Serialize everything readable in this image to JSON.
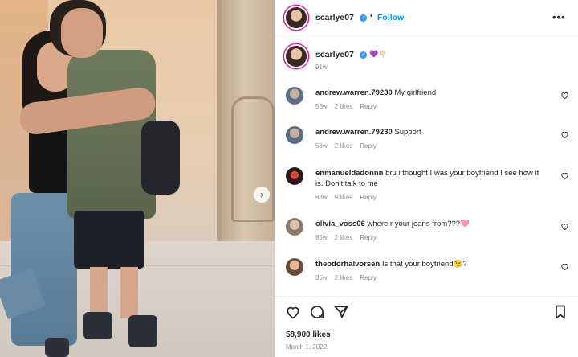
{
  "post": {
    "author": "scarlye07",
    "follow_label": "Follow",
    "more_label": "•••",
    "caption_emoji": "💜👇🏻",
    "caption_time": "91w",
    "likes": "58,900 likes",
    "date": "March 1, 2022"
  },
  "comments": [
    {
      "user": "andrew.warren.79230",
      "text": "My girlfriend",
      "time": "56w",
      "likes": "2 likes",
      "reply": "Reply"
    },
    {
      "user": "andrew.warren.79230",
      "text": "Support",
      "time": "56w",
      "likes": "2 likes",
      "reply": "Reply"
    },
    {
      "user": "enmanueldadonnn",
      "text": "bru i thought I was your boyfriend I see how it is. Don't talk to me",
      "time": "83w",
      "likes": "9 likes",
      "reply": "Reply"
    },
    {
      "user": "olivia_voss06",
      "text": "where r your jeans from???🩷",
      "time": "85w",
      "likes": "2 likes",
      "reply": "Reply"
    },
    {
      "user": "theodorhalvorsen",
      "text": "Is that your boyfriend😉?",
      "time": "85w",
      "likes": "2 likes",
      "reply": "Reply"
    }
  ],
  "icons": {
    "like": "heart-icon",
    "comment": "comment-icon",
    "share": "share-icon",
    "save": "bookmark-icon",
    "next": "chevron-right-icon"
  },
  "colors": {
    "link": "#0095f6",
    "verified": "#3897f0",
    "muted": "#8e8e8e",
    "text": "#262626"
  }
}
